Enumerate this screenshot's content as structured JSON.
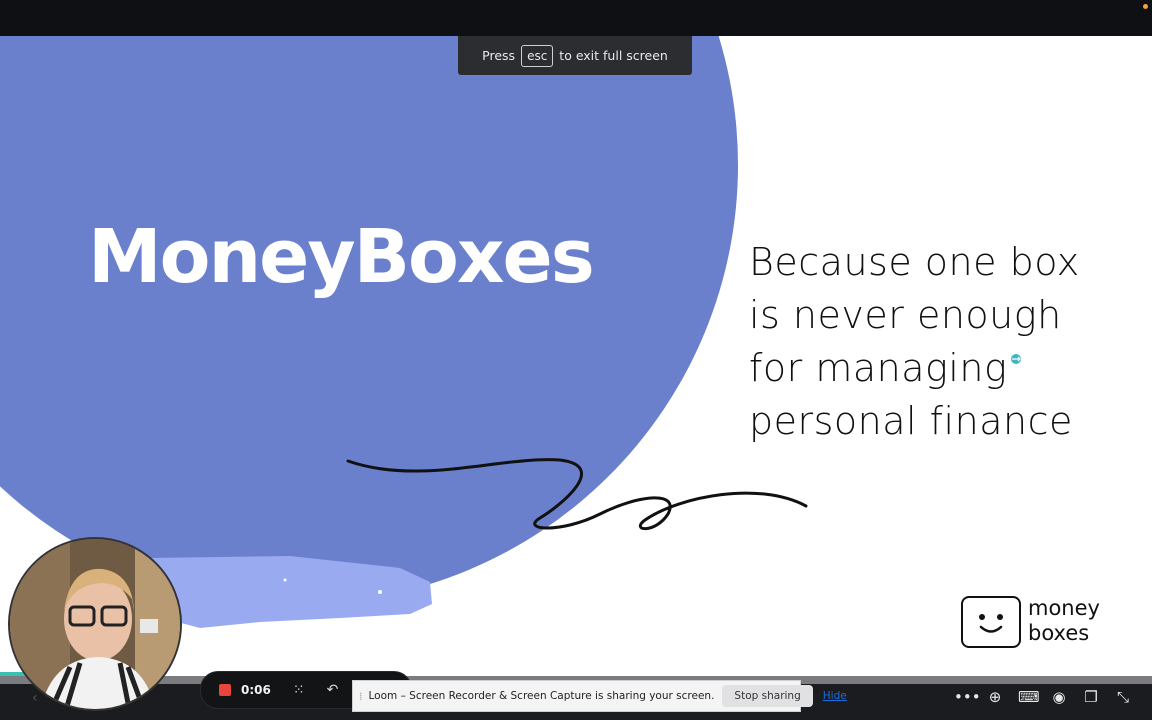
{
  "slide": {
    "title": "MoneyBoxes",
    "tagline_lines": [
      "Because one box",
      "is never enough",
      "for managing",
      "personal finance"
    ],
    "logo_line1": "money",
    "logo_line2": "boxes"
  },
  "fullscreen_hint": {
    "before": "Press",
    "key": "esc",
    "after": "to exit full screen"
  },
  "recorder": {
    "time": "0:06"
  },
  "share_banner": {
    "message": "Loom – Screen Recorder & Screen Capture is sharing your screen.",
    "stop_label": "Stop sharing",
    "hide_label": "Hide"
  },
  "toolbar_icons": [
    "more-icon",
    "zoom-icon",
    "keyboard-icon",
    "broadcast-icon",
    "windows-icon",
    "exit-fullscreen-icon"
  ],
  "colors": {
    "accent": "#6b80cd",
    "brush": "#9aaaf0"
  }
}
